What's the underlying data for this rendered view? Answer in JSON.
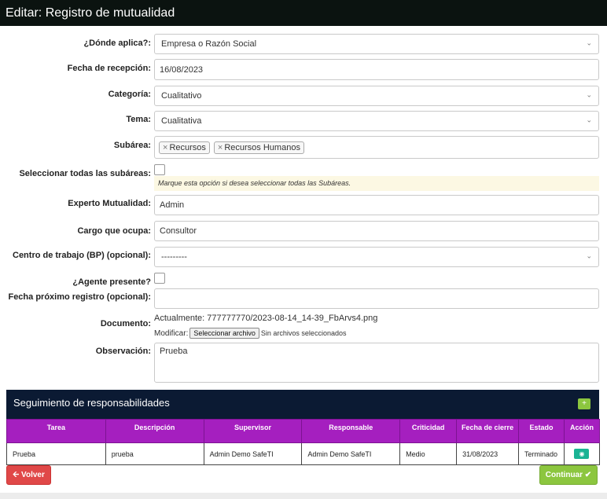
{
  "title": "Editar: Registro de mutualidad",
  "form": {
    "donde_aplica": {
      "label": "¿Dónde aplica?:",
      "value": "Empresa o Razón Social"
    },
    "fecha_recepcion": {
      "label": "Fecha de recepción:",
      "value": "16/08/2023"
    },
    "categoria": {
      "label": "Categoría:",
      "value": "Cualitativo"
    },
    "tema": {
      "label": "Tema:",
      "value": "Cualitativa"
    },
    "subarea": {
      "label": "Subárea:",
      "chips": [
        "Recursos",
        "Recursos Humanos"
      ],
      "remove_symbol": "×"
    },
    "seleccionar_todas": {
      "label": "Seleccionar todas las subáreas:",
      "hint": "Marque esta opción si desea seleccionar todas las Subáreas."
    },
    "experto": {
      "label": "Experto Mutualidad:",
      "value": "Admin"
    },
    "cargo": {
      "label": "Cargo que ocupa:",
      "value": "Consultor"
    },
    "centro_trabajo": {
      "label": "Centro de trabajo (BP) (opcional):",
      "value": "---------"
    },
    "agente_presente": {
      "label": "¿Agente presente?"
    },
    "fecha_proximo": {
      "label": "Fecha próximo registro (opcional):",
      "value": ""
    },
    "documento": {
      "label": "Documento:",
      "current_prefix": "Actualmente:",
      "current_file": "777777770/2023-08-14_14-39_FbArvs4.png",
      "modify_prefix": "Modificar:",
      "button": "Seleccionar archivo",
      "no_file": "Sin archivos seleccionados"
    },
    "observacion": {
      "label": "Observación:",
      "value": "Prueba"
    }
  },
  "seguimiento": {
    "title": "Seguimiento de responsabilidades",
    "add_symbol": "+",
    "columns": [
      "Tarea",
      "Descripción",
      "Supervisor",
      "Responsable",
      "Criticidad",
      "Fecha de cierre",
      "Estado",
      "Acción"
    ],
    "rows": [
      [
        "Prueba",
        "prueba",
        "Admin Demo SafeTI",
        "Admin Demo SafeTI",
        "Medio",
        "31/08/2023",
        "Terminado"
      ]
    ]
  },
  "buttons": {
    "volver": "Volver",
    "continuar": "Continuar"
  },
  "colors": {
    "title_bg": "#0b1310",
    "panel_bg": "#0b1a33",
    "table_header": "#a51fbf",
    "btn_danger": "#e04848",
    "btn_success": "#8cc63f",
    "hint_bg": "#fcf8e3"
  }
}
